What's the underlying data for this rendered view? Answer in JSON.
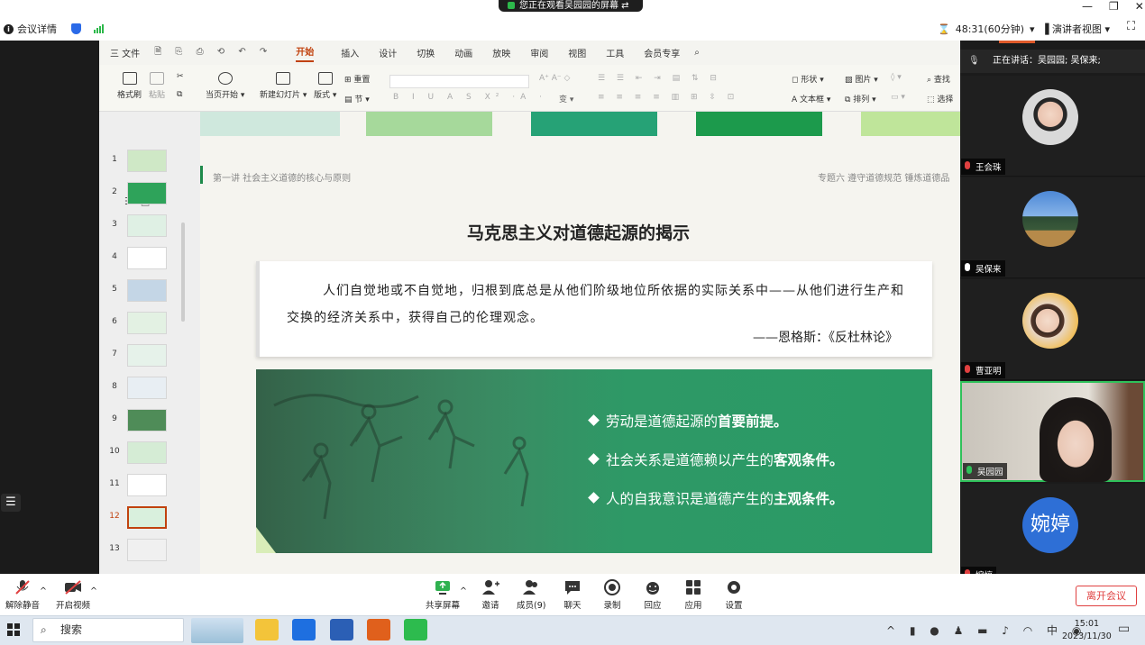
{
  "banner": {
    "text": "您正在观看吴园园的屏幕"
  },
  "meeting": {
    "info_label": "会议详情",
    "timer": "48:31(60分钟)",
    "view_mode": "演讲者视图"
  },
  "wps": {
    "file_menu": "三 文件",
    "tabs": [
      "开始",
      "插入",
      "设计",
      "切换",
      "动画",
      "放映",
      "审阅",
      "视图",
      "工具",
      "会员专享"
    ],
    "active_tab": "开始",
    "ribbon": {
      "format_painter": "格式刷",
      "paste": "粘贴",
      "from_current": "当页开始",
      "new_slide": "新建幻灯片",
      "layout": "版式",
      "reset": "重置",
      "section": "节",
      "shape": "形状",
      "picture": "图片",
      "textbox": "文本框",
      "arrange": "排列",
      "find": "查找",
      "select": "选择"
    },
    "thumbnails": [
      "1",
      "2",
      "3",
      "4",
      "5",
      "6",
      "7",
      "8",
      "9",
      "10",
      "11",
      "12",
      "13"
    ],
    "selected_slide": "12"
  },
  "slide": {
    "section": "第一讲  社会主义道德的核心与原则",
    "topic": "专题六 遵守道德规范 锤炼道德品",
    "title": "马克思主义对道德起源的揭示",
    "quote": "人们自觉地或不自觉地，归根到底总是从他们阶级地位所依据的实际关系中——从他们进行生产和交换的经济关系中，获得自己的伦理观念。",
    "quote_source": "——恩格斯：《反杜林论》",
    "bullets": [
      {
        "normal": "劳动是道德起源的",
        "bold": "首要前提。"
      },
      {
        "normal": "社会关系是道德赖以产生的",
        "bold": "客观条件。"
      },
      {
        "normal": "人的自我意识是道德产生的",
        "bold": "主观条件。"
      }
    ]
  },
  "participants": {
    "speaking": "正在讲话：吴园园; 吴保来;",
    "list": [
      {
        "name": "王会珠",
        "mic": "muted"
      },
      {
        "name": "吴保来",
        "mic": "on"
      },
      {
        "name": "曹亚明",
        "mic": "muted"
      },
      {
        "name": "吴园园",
        "mic": "active"
      },
      {
        "name": "婉婷",
        "mic": "muted",
        "initials": "婉婷",
        "color": "#2e6fd6"
      }
    ]
  },
  "toolbar": {
    "unmute": "解除静音",
    "start_video": "开启视频",
    "share": "共享屏幕",
    "invite": "邀请",
    "members": "成员(9)",
    "chat": "聊天",
    "record": "录制",
    "reactions": "回应",
    "apps": "应用",
    "settings": "设置",
    "leave": "离开会议"
  },
  "taskbar": {
    "search": "搜索",
    "time": "15:01",
    "date": "2023/11/30"
  }
}
